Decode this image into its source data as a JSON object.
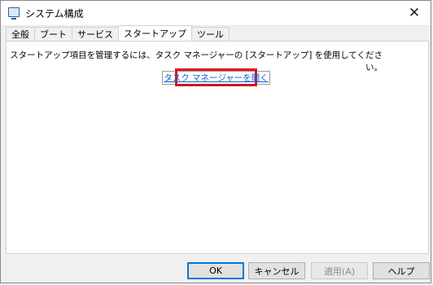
{
  "window": {
    "title": "システム構成",
    "close_label": "✕"
  },
  "tabs": [
    {
      "label": "全般"
    },
    {
      "label": "ブート"
    },
    {
      "label": "サービス"
    },
    {
      "label": "スタートアップ",
      "active": true
    },
    {
      "label": "ツール"
    }
  ],
  "startup_panel": {
    "message": "スタートアップ項目を管理するには、タスク マネージャーの [スタートアップ] を使用してください。",
    "link_label": "タスク マネージャーを開く",
    "highlight_color": "#e3121b"
  },
  "buttons": {
    "ok": "OK",
    "cancel": "キャンセル",
    "apply": "適用(A)",
    "help": "ヘルプ"
  }
}
